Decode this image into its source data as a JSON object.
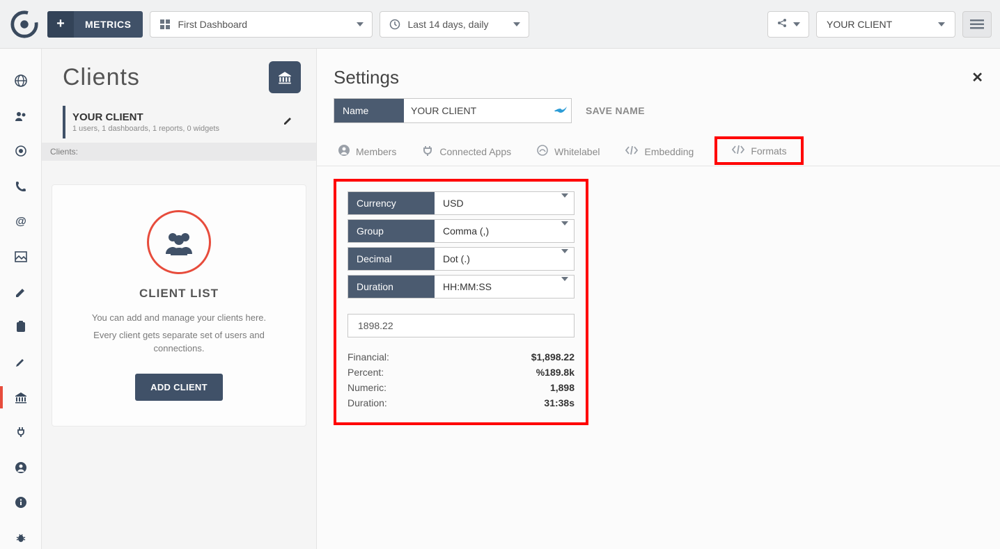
{
  "topbar": {
    "metrics_label": "METRICS",
    "dashboard_label": "First Dashboard",
    "daterange_label": "Last 14 days, daily",
    "client_selector": "YOUR CLIENT"
  },
  "left": {
    "title": "Clients",
    "selected_client": {
      "name": "YOUR CLIENT",
      "summary": "1 users, 1 dashboards, 1 reports, 0 widgets"
    },
    "clients_label": "Clients:",
    "empty": {
      "heading": "CLIENT LIST",
      "line1": "You can add and manage your clients here.",
      "line2": "Every client gets separate set of users and connections.",
      "button": "ADD CLIENT"
    }
  },
  "settings": {
    "title": "Settings",
    "name_label": "Name",
    "name_value": "YOUR CLIENT",
    "save_name": "SAVE NAME",
    "tabs": {
      "members": "Members",
      "connected": "Connected Apps",
      "whitelabel": "Whitelabel",
      "embedding": "Embedding",
      "formats": "Formats"
    }
  },
  "formats": {
    "currency_label": "Currency",
    "currency_value": "USD",
    "group_label": "Group",
    "group_value": "Comma (,)",
    "decimal_label": "Decimal",
    "decimal_value": "Dot (.)",
    "duration_label": "Duration",
    "duration_value": "HH:MM:SS",
    "sample_value": "1898.22",
    "preview": {
      "financial_label": "Financial:",
      "financial_value": "$1,898.22",
      "percent_label": "Percent:",
      "percent_value": "%189.8k",
      "numeric_label": "Numeric:",
      "numeric_value": "1,898",
      "duration_label": "Duration:",
      "duration_value": "31:38s"
    }
  }
}
